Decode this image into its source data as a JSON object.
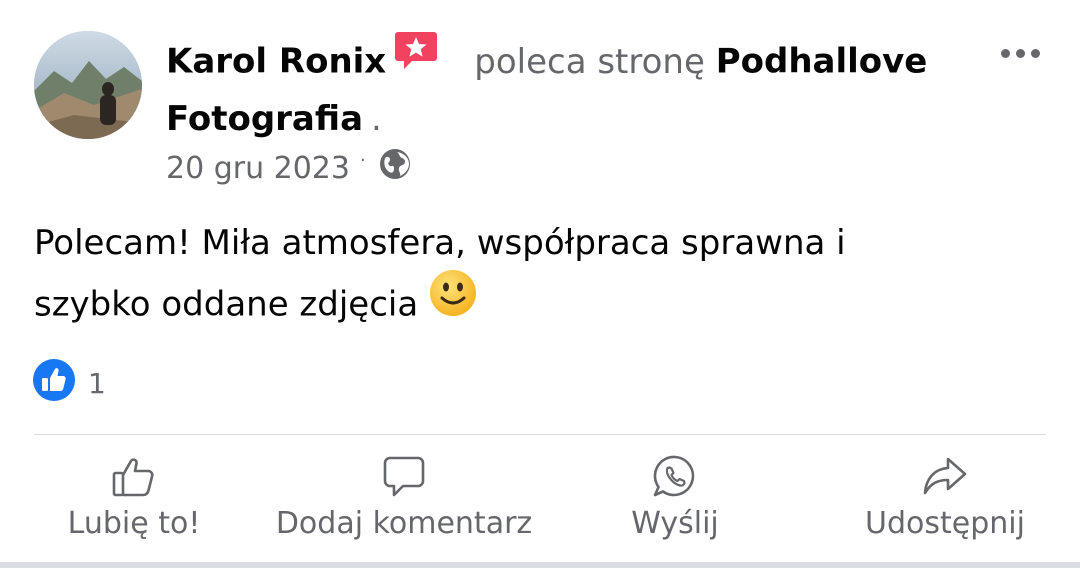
{
  "post": {
    "author": "Karol Ronix",
    "verb": "poleca stronę",
    "page_name": "Podhallove Fotografia",
    "end_dot": ".",
    "date": "20 gru 2023",
    "separator": "·",
    "audience_icon": "globe-icon",
    "text_line1": "Polecam! Miła atmosfera, współpraca sprawna i",
    "text_line2": "szybko oddane zdjęcia",
    "emoji": "slightly-smiling-face"
  },
  "reactions": {
    "icon": "like-icon",
    "count": "1"
  },
  "actions": [
    {
      "label": "Lubię to!",
      "icon": "thumbs-up-icon"
    },
    {
      "label": "Dodaj komentarz",
      "icon": "comment-icon"
    },
    {
      "label": "Wyślij",
      "icon": "whatsapp-icon"
    },
    {
      "label": "Udostępnij",
      "icon": "share-icon"
    }
  ],
  "colors": {
    "accent": "#1877f2",
    "secondary_text": "#65676b",
    "badge": "#f3425f",
    "emoji": "#fbbf24"
  }
}
